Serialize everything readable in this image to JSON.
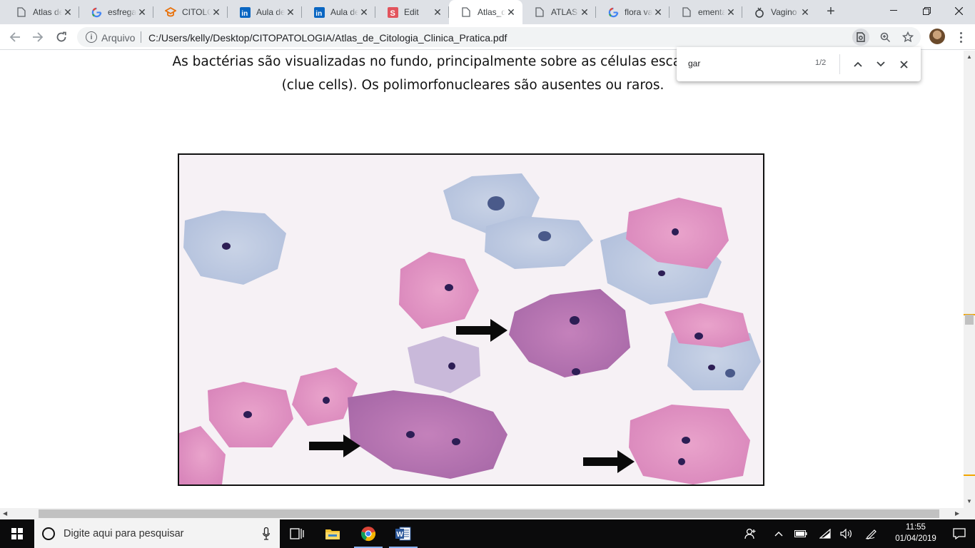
{
  "browser": {
    "tabs": [
      {
        "label": "Atlas de",
        "icon": "page-icon"
      },
      {
        "label": "esfrega",
        "icon": "google-icon"
      },
      {
        "label": "CITOLO",
        "icon": "mortarboard-icon"
      },
      {
        "label": "Aula de",
        "icon": "linkedin-icon"
      },
      {
        "label": "Aula de",
        "icon": "linkedin-icon"
      },
      {
        "label": "Edit",
        "icon": "s-logo-icon"
      },
      {
        "label": "Atlas_de",
        "icon": "page-icon",
        "active": true
      },
      {
        "label": "ATLAS",
        "icon": "page-icon"
      },
      {
        "label": "flora va",
        "icon": "google-icon"
      },
      {
        "label": "ementa",
        "icon": "page-icon"
      },
      {
        "label": "Vagino",
        "icon": "bulb-icon"
      }
    ],
    "scheme_label": "Arquivo",
    "url": "C:/Users/kelly/Desktop/CITOPATOLOGIA/Atlas_de_Citologia_Clinica_Pratica.pdf"
  },
  "find_bar": {
    "query": "gar",
    "count": "1/2"
  },
  "document": {
    "line1": "As bactérias são visualizadas no fundo, principalmente sobre as células escamosas resulta",
    "line2": "(clue cells). Os polimorfonucleares são ausentes ou raros."
  },
  "taskbar": {
    "search_placeholder": "Digite aqui para pesquisar",
    "time": "11:55",
    "date": "01/04/2019"
  },
  "colors": {
    "tab_strip": "#dee1e6",
    "find_marker": "#f2a600",
    "taskbar": "#0b0b0c"
  }
}
